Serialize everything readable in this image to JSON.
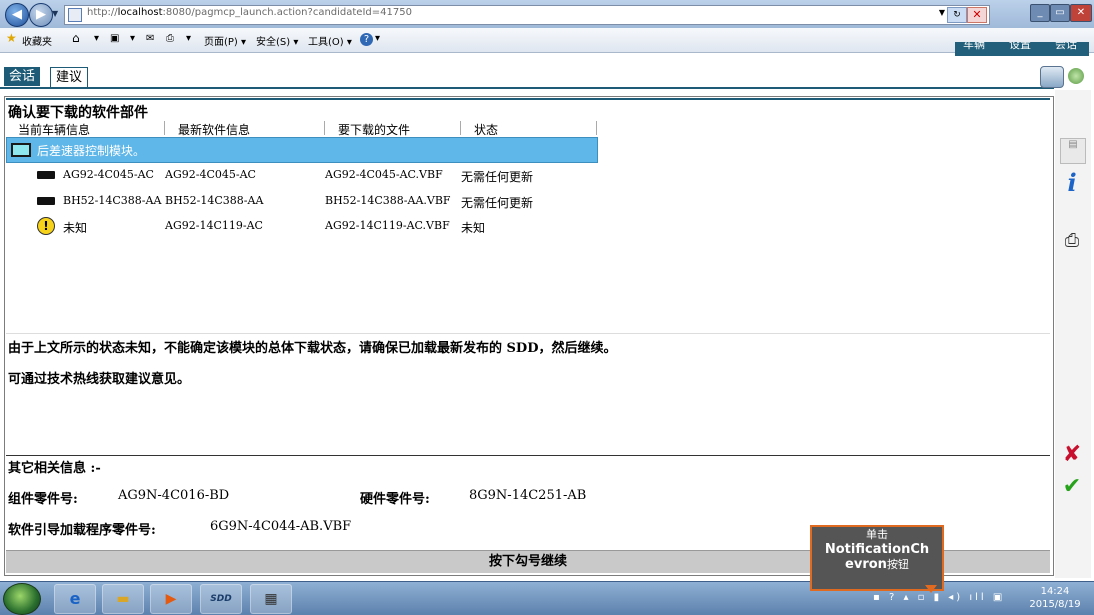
{
  "browser": {
    "url_prefix": "http://",
    "url_host": "localhost",
    "url_rest": ":8080/pagmcp_launch.action?candidateId=41750",
    "favorites": "收藏夹",
    "menu": [
      "页面(P) ▾",
      "安全(S) ▾",
      "工具(O) ▾"
    ]
  },
  "app": {
    "top_tabs_right": [
      "车辆",
      "设置",
      "会话"
    ],
    "tabs": [
      "会话",
      "建议"
    ],
    "panel_title": "确认要下载的软件部件",
    "columns": [
      "当前车辆信息",
      "最新软件信息",
      "要下载的文件",
      "状态"
    ],
    "selected_module": "后差速器控制模块。",
    "rows": [
      {
        "current": "AG92-4C045-AC",
        "latest": "AG92-4C045-AC",
        "file": "AG92-4C045-AC.VBF",
        "status": "无需任何更新",
        "icon": "chip-icon"
      },
      {
        "current": "BH52-14C388-AA",
        "latest": "BH52-14C388-AA",
        "file": "BH52-14C388-AA.VBF",
        "status": "无需任何更新",
        "icon": "chip-icon"
      },
      {
        "current": "未知",
        "latest": "AG92-14C119-AC",
        "file": "AG92-14C119-AC.VBF",
        "status": "未知",
        "icon": "warning-icon"
      }
    ],
    "message1": "由于上文所示的状态未知，不能确定该模块的总体下载状态，请确保已加载最新发布的 SDD，然后继续。",
    "message2": "可通过技术热线获取建议意见。",
    "other_info_label": "其它相关信息 :-",
    "component_part_label": "组件零件号:",
    "component_part_value": "AG9N-4C016-BD",
    "hardware_part_label": "硬件零件号:",
    "hardware_part_value": "8G9N-14C251-AB",
    "bootloader_label": "软件引导加载程序零件号:",
    "bootloader_value": "6G9N-4C044-AB.VBF",
    "continue_prompt": "按下勾号继续"
  },
  "taskbar": {
    "sdd_label": "SDD",
    "time": "14:24",
    "date": "2015/8/19"
  },
  "tooltip": {
    "line1": "单击",
    "line2": "NotificationCh",
    "line3": "evron",
    "line3_suffix": "按钮"
  }
}
